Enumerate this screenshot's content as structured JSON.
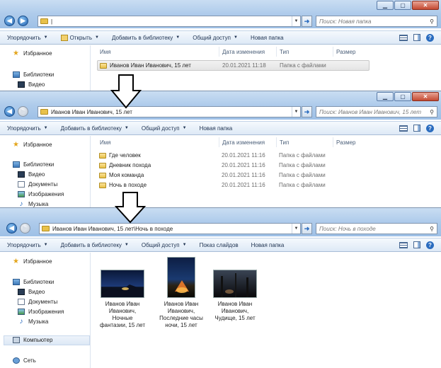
{
  "window1": {
    "address": "|",
    "search_placeholder": "Поиск: Новая папка",
    "toolbar": [
      "Упорядочить",
      "Открыть",
      "Добавить в библиотеку",
      "Общий доступ",
      "Новая папка"
    ],
    "nav": {
      "favorites": "Избранное",
      "libraries": "Библиотеки",
      "video": "Видео"
    },
    "columns": {
      "name": "Имя",
      "date": "Дата изменения",
      "type": "Тип",
      "size": "Размер"
    },
    "rows": [
      {
        "name": "Иванов Иван Иванович, 15 лет",
        "date": "20.01.2021 11:18",
        "type": "Папка с файлами"
      }
    ]
  },
  "window2": {
    "address": "Иванов Иван Иванович, 15 лет",
    "search_placeholder": "Поиск: Иванов Иван Иванович, 15 лет",
    "toolbar": [
      "Упорядочить",
      "Добавить в библиотеку",
      "Общий доступ",
      "Новая папка"
    ],
    "nav": {
      "favorites": "Избранное",
      "libraries": "Библиотеки",
      "video": "Видео",
      "documents": "Документы",
      "images": "Изображения",
      "music": "Музыка"
    },
    "columns": {
      "name": "Имя",
      "date": "Дата изменения",
      "type": "Тип",
      "size": "Размер"
    },
    "rows": [
      {
        "name": "Где человек",
        "date": "20.01.2021 11:16",
        "type": "Папка с файлами"
      },
      {
        "name": "Дневник похода",
        "date": "20.01.2021 11:16",
        "type": "Папка с файлами"
      },
      {
        "name": "Моя команда",
        "date": "20.01.2021 11:16",
        "type": "Папка с файлами"
      },
      {
        "name": "Ночь в походе",
        "date": "20.01.2021 11:16",
        "type": "Папка с файлами"
      }
    ]
  },
  "window3": {
    "address": "Иванов Иван Иванович, 15 лет\\Ночь в походе",
    "search_placeholder": "Поиск: Ночь в походе",
    "toolbar": [
      "Упорядочить",
      "Добавить в библиотеку",
      "Общий доступ",
      "Показ слайдов",
      "Новая папка"
    ],
    "nav": {
      "favorites": "Избранное",
      "libraries": "Библиотеки",
      "video": "Видео",
      "documents": "Документы",
      "images": "Изображения",
      "music": "Музыка",
      "computer": "Компьютер",
      "network": "Сеть"
    },
    "files": [
      {
        "l1": "Иванов Иван",
        "l2": "Иванович,",
        "l3": "Ночные",
        "l4": "фантазии, 15 лет"
      },
      {
        "l1": "Иванов Иван",
        "l2": "Иванович,",
        "l3": "Последние часы",
        "l4": "ночи, 15 лет"
      },
      {
        "l1": "Иванов Иван",
        "l2": "Иванович,",
        "l3": "Чудище, 15 лет",
        "l4": ""
      }
    ]
  },
  "icons": {
    "back": "back-arrow-icon",
    "forward": "forward-arrow-icon",
    "go": "go-arrow-icon",
    "search": "search-icon",
    "down_arrow": "down-arrow-icon"
  },
  "colors": {
    "chrome": "#aecbeb",
    "accent": "#2a6cbf"
  }
}
